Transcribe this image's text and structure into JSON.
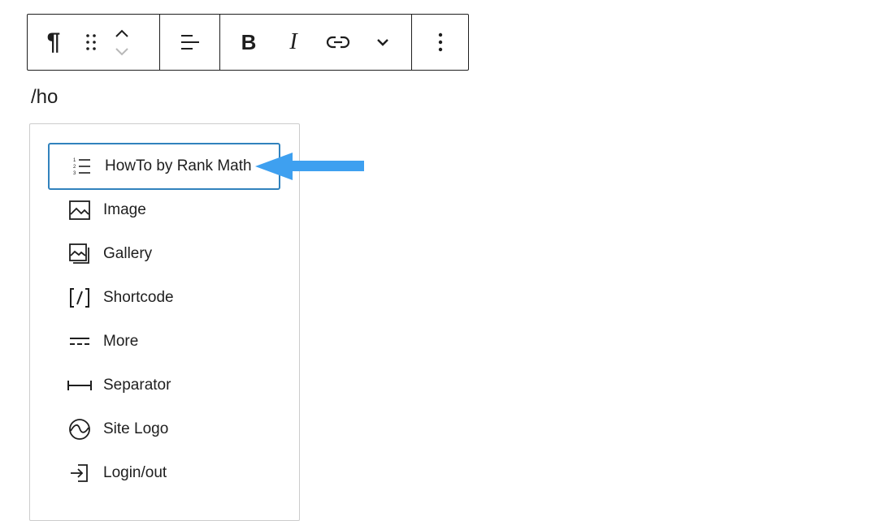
{
  "toolbar": {
    "paragraph_glyph": "¶",
    "bold_label": "B",
    "italic_label": "I",
    "icons": [
      "paragraph-icon",
      "drag-handle-icon",
      "move-up-icon",
      "move-down-icon",
      "align-left-icon",
      "bold-icon",
      "italic-icon",
      "link-icon",
      "chevron-down-icon",
      "more-options-icon"
    ]
  },
  "editor": {
    "slash_text": "/ho"
  },
  "inserter": {
    "items": [
      {
        "label": "HowTo by Rank Math",
        "icon": "ordered-list-icon",
        "selected": true
      },
      {
        "label": "Image",
        "icon": "image-icon"
      },
      {
        "label": "Gallery",
        "icon": "gallery-icon"
      },
      {
        "label": "Shortcode",
        "icon": "shortcode-icon"
      },
      {
        "label": "More",
        "icon": "more-icon"
      },
      {
        "label": "Separator",
        "icon": "separator-icon"
      },
      {
        "label": "Site Logo",
        "icon": "site-logo-icon"
      },
      {
        "label": "Login/out",
        "icon": "login-icon"
      }
    ]
  },
  "colors": {
    "selected_border": "#3182bd",
    "arrow": "#3ea0f0",
    "text": "#1e1e1e"
  }
}
